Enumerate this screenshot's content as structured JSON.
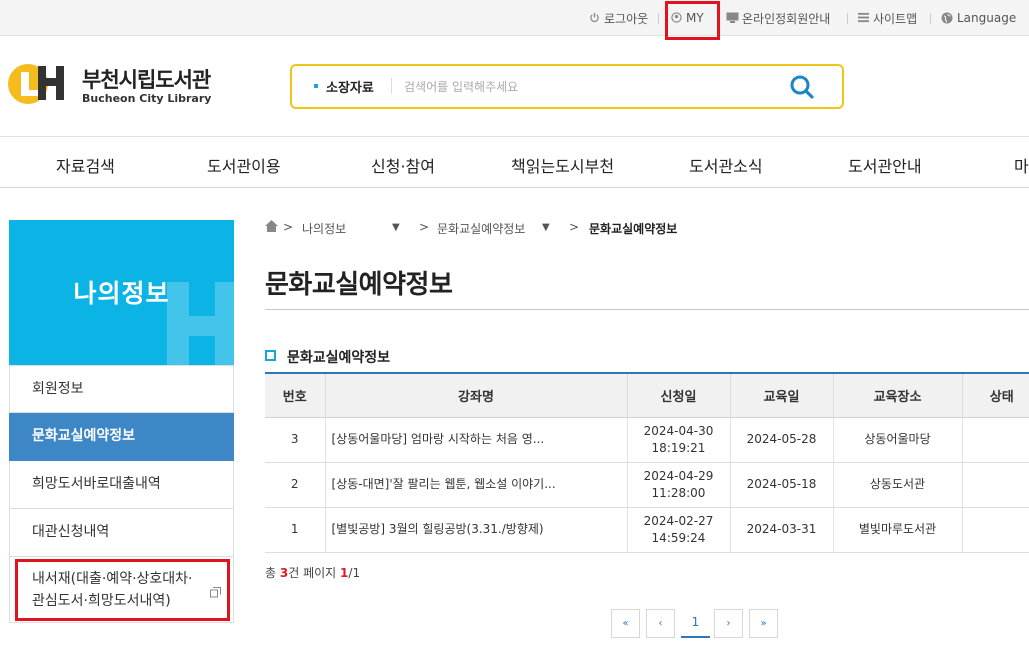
{
  "utility": {
    "logout": "로그아웃",
    "my": "MY",
    "online_member": "온라인정회원안내",
    "sitemap": "사이트맵",
    "language": "Language"
  },
  "logo": {
    "name": "부천시립도서관",
    "sub": "Bucheon City Library"
  },
  "search": {
    "category": "소장자료",
    "placeholder": "검색어를 입력해주세요"
  },
  "gnb": [
    "자료검색",
    "도서관이용",
    "신청·참여",
    "책읽는도시부천",
    "도서관소식",
    "도서관안내",
    "마"
  ],
  "side": {
    "title": "나의정보",
    "menu": [
      "회원정보",
      "문화교실예약정보",
      "희망도서바로대출내역",
      "대관신청내역",
      "내서재(대출·예약·상호대차·관심도서·희망도서내역)"
    ]
  },
  "breadcrumb": {
    "level1": "나의정보",
    "level2": "문화교실예약정보",
    "current": "문화교실예약정보"
  },
  "page_title": "문화교실예약정보",
  "section_title": "문화교실예약정보",
  "table": {
    "headers": [
      "번호",
      "강좌명",
      "신청일",
      "교육일",
      "교육장소",
      "상태"
    ],
    "rows": [
      {
        "no": "3",
        "title": "[상동어울마당] 엄마랑 시작하는 처음 영...",
        "applied": "2024-04-30",
        "applied_time": "18:19:21",
        "edu_date": "2024-05-28",
        "place": "상동어울마당",
        "status": ""
      },
      {
        "no": "2",
        "title": "[상동-대면]'잘 팔리는 웹툰, 웹소설 이야기...",
        "applied": "2024-04-29",
        "applied_time": "11:28:00",
        "edu_date": "2024-05-18",
        "place": "상동도서관",
        "status": ""
      },
      {
        "no": "1",
        "title": "[별빛공방] 3월의 힐링공방(3.31./방향제)",
        "applied": "2024-02-27",
        "applied_time": "14:59:24",
        "edu_date": "2024-03-31",
        "place": "별빛마루도서관",
        "status": ""
      }
    ]
  },
  "totals": {
    "prefix": "총",
    "count": "3",
    "mid": "건 페이지",
    "page": "1",
    "suffix": "/1"
  },
  "pagination": {
    "first": "«",
    "prev": "‹",
    "current": "1",
    "next": "›",
    "last": "»"
  },
  "colors": {
    "highlight_box": "#e0141e",
    "side_header": "#0cb4e6",
    "active_menu": "#3d87c6",
    "search_border": "#f0c419",
    "table_top_border": "#2e77bb"
  }
}
